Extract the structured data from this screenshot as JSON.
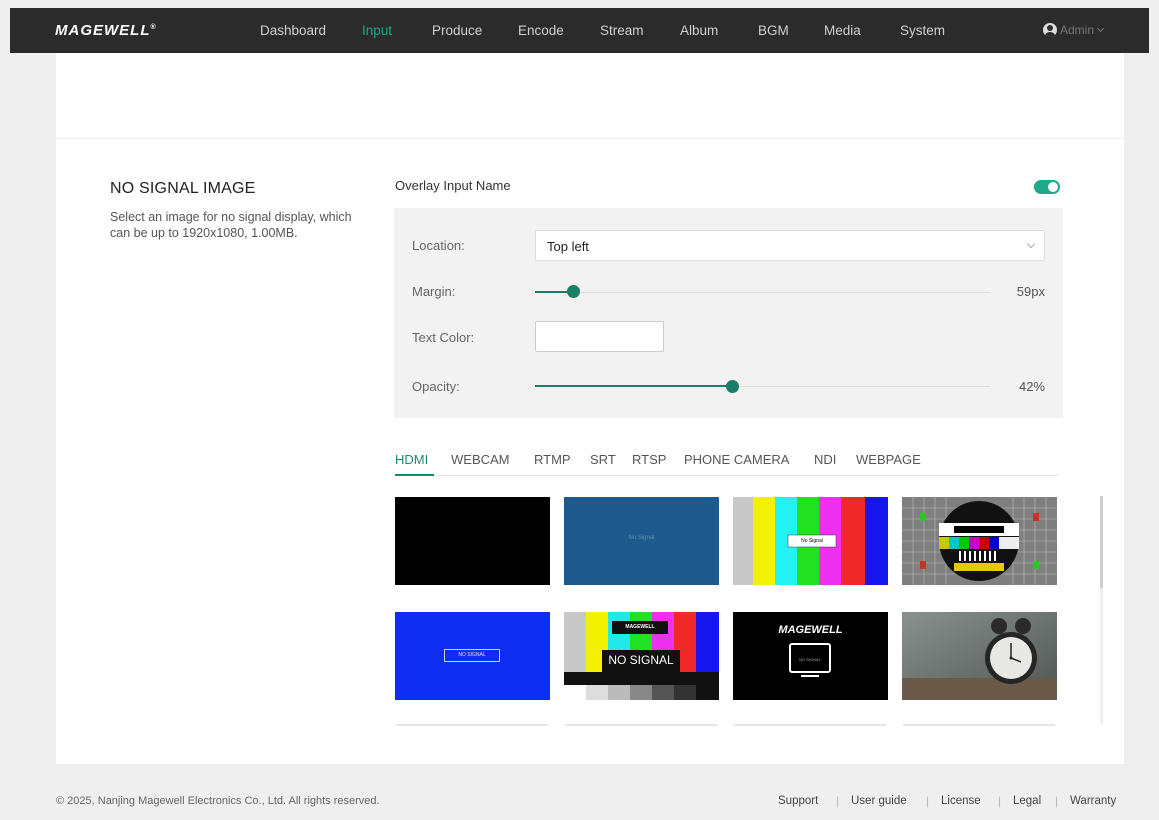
{
  "header": {
    "logo": "MAGEWELL",
    "logo_mark": "®",
    "nav": [
      {
        "label": "Dashboard",
        "active": false
      },
      {
        "label": "Input",
        "active": true
      },
      {
        "label": "Produce",
        "active": false
      },
      {
        "label": "Encode",
        "active": false
      },
      {
        "label": "Stream",
        "active": false
      },
      {
        "label": "Album",
        "active": false
      },
      {
        "label": "BGM",
        "active": false
      },
      {
        "label": "Media",
        "active": false
      },
      {
        "label": "System",
        "active": false
      }
    ],
    "user": "Admin",
    "user_icon": "user-icon",
    "user_chevron": "chevron-down-icon"
  },
  "section": {
    "title": "NO SIGNAL IMAGE",
    "description": "Select an image for no signal display, which can be up to 1920x1080, 1.00MB."
  },
  "overlay": {
    "label": "Overlay Input Name",
    "enabled": true,
    "location_label": "Location:",
    "location_value": "Top left",
    "margin_label": "Margin:",
    "margin_value": "59px",
    "margin_fraction": 0.08,
    "text_color_label": "Text Color:",
    "text_color_value": "#ffffff",
    "opacity_label": "Opacity:",
    "opacity_value": "42%",
    "opacity_fraction": 0.42
  },
  "tabs": [
    {
      "label": "HDMI",
      "active": true
    },
    {
      "label": "WEBCAM",
      "active": false
    },
    {
      "label": "RTMP",
      "active": false
    },
    {
      "label": "SRT",
      "active": false
    },
    {
      "label": "RTSP",
      "active": false
    },
    {
      "label": "PHONE CAMERA",
      "active": false
    },
    {
      "label": "NDI",
      "active": false
    },
    {
      "label": "WEBPAGE",
      "active": false
    }
  ],
  "thumbnails": [
    {
      "kind": "black"
    },
    {
      "kind": "blue-no-signal",
      "text": "No Signal"
    },
    {
      "kind": "color-bars",
      "text": "No Signal"
    },
    {
      "kind": "test-card"
    },
    {
      "kind": "blue-box",
      "text": "NO SIGNAL"
    },
    {
      "kind": "bars-magewell",
      "brand": "MAGEWELL",
      "text": "NO SIGNAL"
    },
    {
      "kind": "magewell-black",
      "brand": "MAGEWELL",
      "text": "NO SIGNAL"
    },
    {
      "kind": "alarm-clock"
    }
  ],
  "colors": {
    "accent": "#1fa88a",
    "accent_dark": "#1a7f66",
    "topbar": "#2b2b2b"
  },
  "footer": {
    "copyright": "© 2025, Nanjing Magewell Electronics Co., Ltd. All rights reserved.",
    "links": [
      "Support",
      "User guide",
      "License",
      "Legal",
      "Warranty"
    ]
  }
}
